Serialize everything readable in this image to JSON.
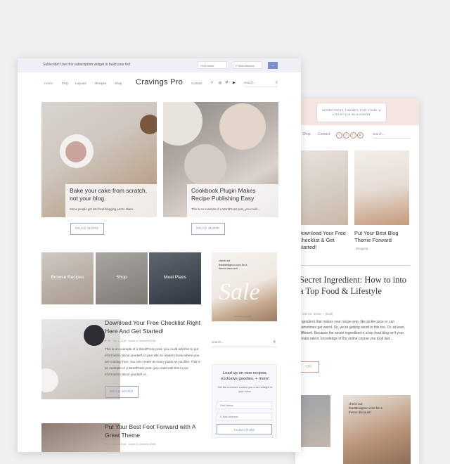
{
  "back": {
    "logo_text": "WORDPRESS THEMES FOR FOOD & LIFESTYLE BLOGGERS",
    "nav": [
      "Shop",
      "Contact"
    ],
    "social": [
      "f",
      "◎",
      "P",
      "▶"
    ],
    "search_placeholder": "search...",
    "post1_title": "Download Your Free Checklist & Get Started!",
    "post2_title": "Put Your Best Blog Theme Forward",
    "post2_tag": "Blogging",
    "big_title": "Secret Ingredient: How to into a Top Food & Lifestyle",
    "big_meta": "Oct 24, 2018  —  (Edit)",
    "big_excerpt": "ingredient that makes your recipe pop, like pickle juice or can sometimes get weird. So, we're getting weird in this too. Or, at least, different. Because the secret ingredient to a top food blog isn't your innate talent, knowledge of the online course you took last...",
    "read_more": "ON",
    "sale_text": "check out feastdesignco.com for a theme discount!"
  },
  "front": {
    "subscribe_text": "Subscribe! Use this subscription widget to build your list!",
    "first_name_placeholder": "First Name",
    "email_placeholder": "E-Mail Address",
    "submit_icon": "→",
    "nav_left": [
      "Home",
      "FAQ",
      "Layouts",
      "Recipes",
      "Shop"
    ],
    "brand": "Cravings Pro",
    "nav_contact": "Contact",
    "social_icons": [
      "f",
      "◎",
      "P",
      "▶"
    ],
    "search_placeholder": "search...",
    "search_icon": "⚲",
    "featured": [
      {
        "title": "Bake your cake from scratch, not your blog.",
        "excerpt": "Some people get into food-blogging just to share...",
        "button": "READ MORE"
      },
      {
        "title": "Cookbook Plugin Makes Recipe Publishing Easy",
        "excerpt": "This is an example of a WordPress post, you could...",
        "button": "READ MORE"
      }
    ],
    "tiles": [
      "Browse Recipes",
      "Shop",
      "Meal Plans"
    ],
    "sale": {
      "text": "check out feastdesignco.com for a theme discount!",
      "big": "Sale",
      "small": "feastdesignco.com"
    },
    "posts": [
      {
        "title": "Download Your Free Checklist Right Here And Get Started!",
        "meta": "❤ 1K  ·  Jun 1, 2018  ·  Leave a Comment (Edit)",
        "excerpt": "This is an example of a WordPress post, you could edit this to put information about yourself or your site so readers know where you are coming from. You can create as many posts as you like. This is an example of a WordPress post, you could edit this to put information about yourself or...",
        "button": "READ MORE"
      },
      {
        "title": "Put Your Best Foot Forward with A Great Theme",
        "meta": "❤ 1K  ·  Jun 1, 2018  ·  Leave a Comment (Edit)"
      }
    ],
    "sidebar_search": "search...",
    "optin": {
      "title": "Load up on new recipes, exclusive goodies, + more!",
      "desc": "Get the exclusive content you crave straight to your inbox.",
      "first_name": "First Name",
      "email": "E-Mail Address",
      "button": "SUBSCRIBE"
    }
  }
}
